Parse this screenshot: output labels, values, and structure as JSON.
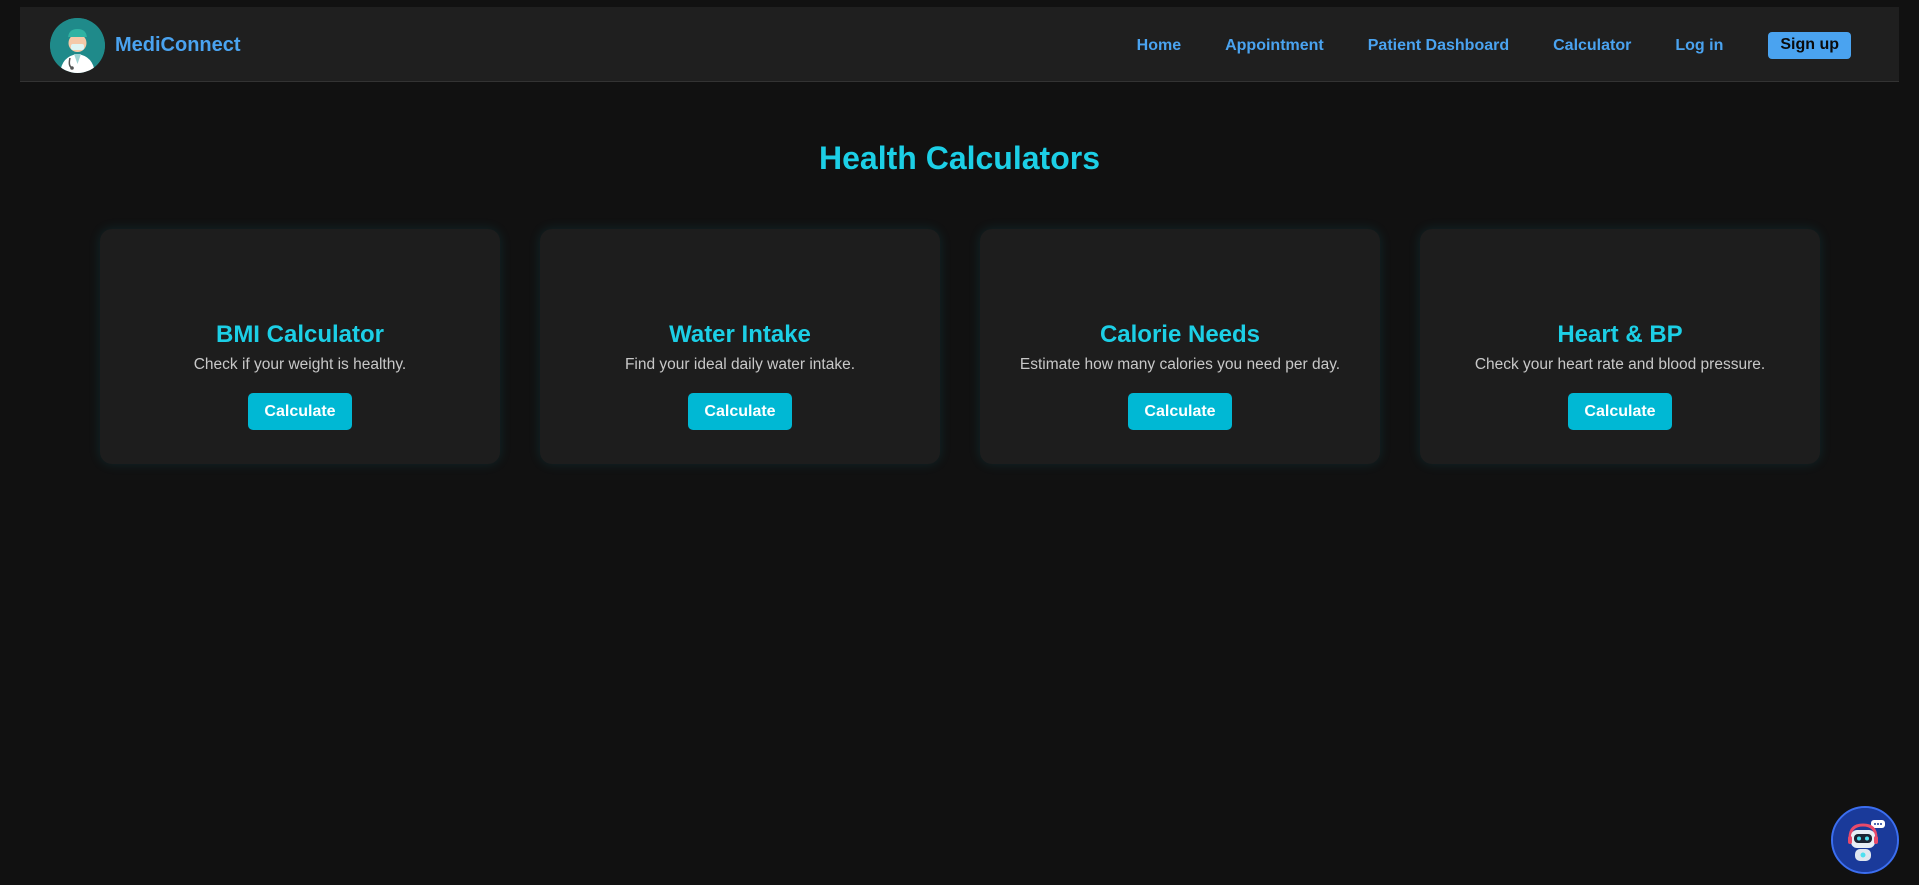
{
  "brand": {
    "name": "MediConnect",
    "logo_icon": "doctor-avatar-icon"
  },
  "nav": {
    "links": [
      "Home",
      "Appointment",
      "Patient Dashboard",
      "Calculator",
      "Log in"
    ],
    "signup_label": "Sign up"
  },
  "main": {
    "title": "Health Calculators",
    "cards": [
      {
        "title": "BMI Calculator",
        "description": "Check if your weight is healthy.",
        "button": "Calculate"
      },
      {
        "title": "Water Intake",
        "description": "Find your ideal daily water intake.",
        "button": "Calculate"
      },
      {
        "title": "Calorie Needs",
        "description": "Estimate how many calories you need per day.",
        "button": "Calculate"
      },
      {
        "title": "Heart & BP",
        "description": "Check your heart rate and blood pressure.",
        "button": "Calculate"
      }
    ]
  },
  "chatbot": {
    "icon": "robot-chat-icon"
  },
  "colors": {
    "accent": "#1ccfe6",
    "link": "#4aa3f0",
    "button": "#00b8d4",
    "background": "#111111",
    "card": "#1d1d1d"
  }
}
